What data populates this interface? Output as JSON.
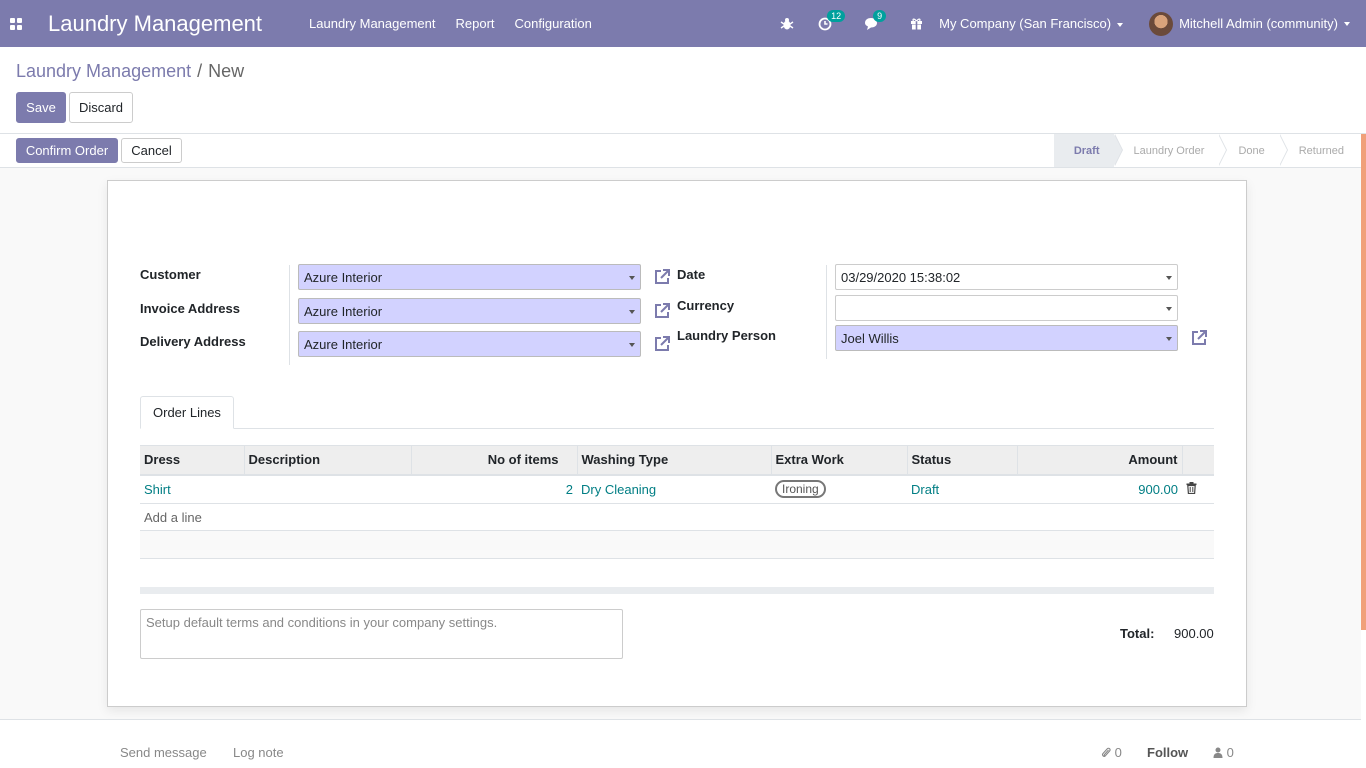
{
  "navbar": {
    "brand": "Laundry Management",
    "menu": [
      "Laundry Management",
      "Report",
      "Configuration"
    ],
    "activity_count": "12",
    "messages_count": "9",
    "company": "My Company (San Francisco)",
    "user": "Mitchell Admin (community)"
  },
  "breadcrumb": {
    "parent": "Laundry Management",
    "separator": "/",
    "current": "New"
  },
  "buttons": {
    "save": "Save",
    "discard": "Discard",
    "confirm_order": "Confirm Order",
    "cancel": "Cancel"
  },
  "stages": [
    {
      "label": "Draft",
      "active": true
    },
    {
      "label": "Laundry Order",
      "active": false
    },
    {
      "label": "Done",
      "active": false
    },
    {
      "label": "Returned",
      "active": false
    }
  ],
  "form": {
    "customer": {
      "label": "Customer",
      "value": "Azure Interior"
    },
    "invoice_address": {
      "label": "Invoice Address",
      "value": "Azure Interior"
    },
    "delivery_address": {
      "label": "Delivery Address",
      "value": "Azure Interior"
    },
    "date": {
      "label": "Date",
      "value": "03/29/2020 15:38:02"
    },
    "currency": {
      "label": "Currency",
      "value": ""
    },
    "laundry_person": {
      "label": "Laundry Person",
      "value": "Joel Willis"
    }
  },
  "notebook": {
    "tab": "Order Lines",
    "columns": [
      "Dress",
      "Description",
      "No of items",
      "Washing Type",
      "Extra Work",
      "Status",
      "Amount"
    ],
    "rows": [
      {
        "dress": "Shirt",
        "description": "",
        "items": "2",
        "washing_type": "Dry Cleaning",
        "extra_work": "Ironing",
        "status": "Draft",
        "amount": "900.00"
      }
    ],
    "add_line": "Add a line"
  },
  "terms_placeholder": "Setup default terms and conditions in your company settings.",
  "totals": {
    "label": "Total:",
    "value": "900.00"
  },
  "chatter": {
    "send_message": "Send message",
    "log_note": "Log note",
    "attachments": "0",
    "follow": "Follow",
    "followers": "0"
  },
  "colors": {
    "primary": "#7c7bad",
    "link": "#017e84",
    "required_bg": "#d2d2ff",
    "badge": "#00a09d"
  }
}
